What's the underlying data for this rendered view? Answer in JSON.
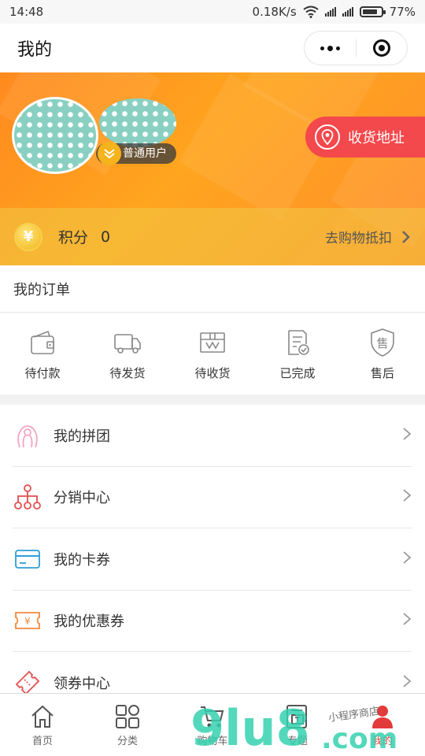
{
  "status_bar": {
    "time": "14:48",
    "network_speed": "0.18K/s",
    "battery": "77%"
  },
  "title_bar": {
    "title": "我的"
  },
  "profile": {
    "member_level": "普通用户",
    "address_button": "收货地址"
  },
  "points": {
    "label": "积分",
    "value": "0",
    "deduct_link": "去购物抵扣"
  },
  "orders": {
    "title": "我的订单",
    "items": [
      {
        "label": "待付款",
        "icon": "wallet-icon"
      },
      {
        "label": "待发货",
        "icon": "truck-icon"
      },
      {
        "label": "待收货",
        "icon": "package-icon"
      },
      {
        "label": "已完成",
        "icon": "completed-doc-icon"
      },
      {
        "label": "售后",
        "icon": "after-sale-shield-icon"
      }
    ]
  },
  "menu": {
    "items": [
      {
        "label": "我的拼团",
        "icon": "group-buy-icon"
      },
      {
        "label": "分销中心",
        "icon": "distribution-network-icon"
      },
      {
        "label": "我的卡券",
        "icon": "card-icon"
      },
      {
        "label": "我的优惠券",
        "icon": "coupon-icon"
      },
      {
        "label": "领券中心",
        "icon": "ticket-icon"
      }
    ]
  },
  "tab_bar": {
    "items": [
      {
        "label": "首页",
        "icon": "home-icon"
      },
      {
        "label": "分类",
        "icon": "category-icon"
      },
      {
        "label": "购物车",
        "icon": "cart-icon"
      },
      {
        "label": "专题",
        "icon": "topic-icon"
      },
      {
        "label": "我的",
        "icon": "profile-icon",
        "active": true
      }
    ]
  },
  "watermark": {
    "text_main": "9lu8",
    "text_domain": ".com",
    "text_small": "小程序商店"
  },
  "colors": {
    "primary_orange": "#ff9a1f",
    "address_red": "#f3484c",
    "active_tab": "#e23b3b"
  }
}
